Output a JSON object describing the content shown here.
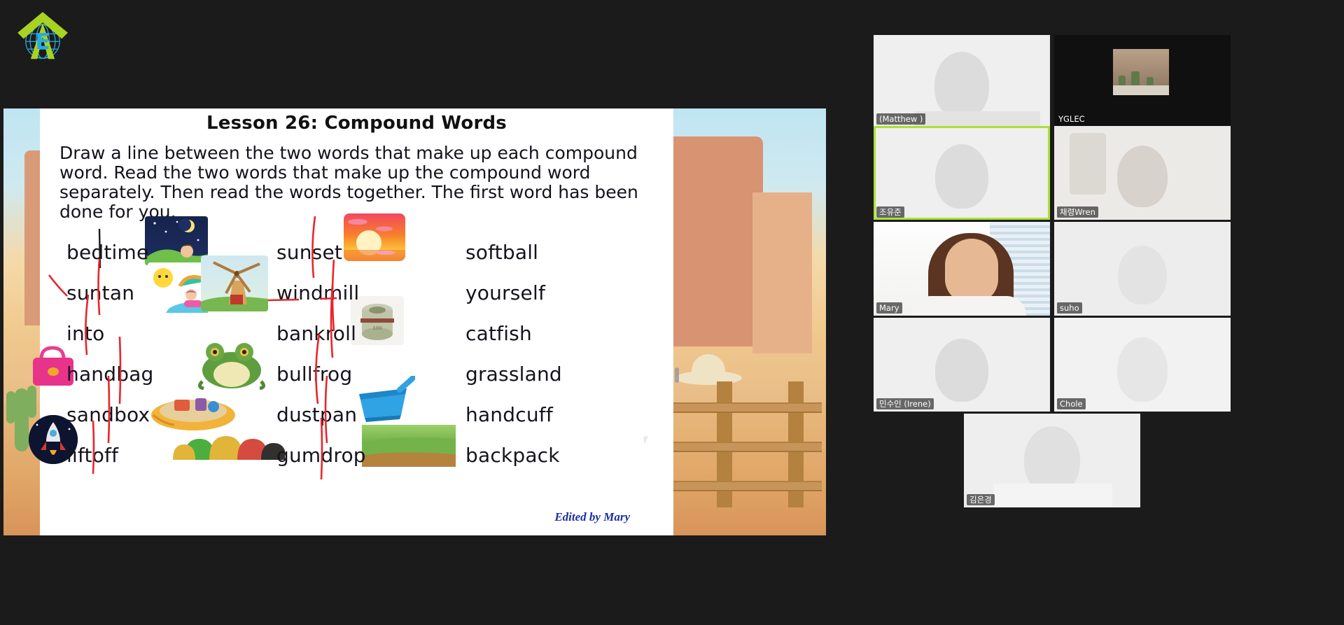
{
  "app": {
    "background_color": "#1b1b1b",
    "logo": {
      "name": "academy-globe-logo",
      "letter": "E",
      "arrow_color": "#a8d320",
      "globe_color": "#29abe2"
    }
  },
  "shared_screen": {
    "name": "shared-slide",
    "worksheet": {
      "title": "Lesson 26: Compound Words",
      "instructions": "Draw a line between the two words that make up each compound word. Read the two words that make up the compound word separately. Then read the words together. The first word has been done for you.",
      "columns": [
        {
          "index": 1,
          "words": [
            "bedtime",
            "suntan",
            "into",
            "handbag",
            "sandbox",
            "liftoff"
          ]
        },
        {
          "index": 2,
          "words": [
            "sunset",
            "windmill",
            "bankroll",
            "bullfrog",
            "dustpan",
            "gumdrop"
          ]
        },
        {
          "index": 3,
          "words": [
            "softball",
            "yourself",
            "catfish",
            "grassland",
            "handcuff",
            "backpack"
          ]
        }
      ],
      "clipart": [
        {
          "label": "night-sky-sleeping-child",
          "column": 1,
          "row": 1
        },
        {
          "label": "beach-umbrella-sunbathing",
          "column": 1,
          "row": 2
        },
        {
          "label": "pink-handbag",
          "column": 1,
          "row": 4
        },
        {
          "label": "sandbox-with-toys",
          "column": 1,
          "row": 5
        },
        {
          "label": "rocket-liftoff",
          "column": 1,
          "row": 6
        },
        {
          "label": "gumdrops-candy",
          "column": 1,
          "row": 6
        },
        {
          "label": "windmill",
          "column": 2,
          "row": 2
        },
        {
          "label": "sunset-ocean",
          "column": 2,
          "row": 1
        },
        {
          "label": "roll-of-money",
          "column": 2,
          "row": 3
        },
        {
          "label": "green-bullfrog",
          "column": 2,
          "row": 4
        },
        {
          "label": "blue-dustpan",
          "column": 2,
          "row": 5
        },
        {
          "label": "grass-field",
          "column": 3,
          "row": 5
        }
      ],
      "annotation_color": "#e8262b",
      "credit": "Edited by Mary"
    },
    "slide_background": "desert-western-scene"
  },
  "video_grid": {
    "name": "participant-grid",
    "active_speaker": "조유준",
    "active_border_color": "#aee034",
    "participants": [
      {
        "name": "(Matthew )",
        "video_on": false,
        "row": 1,
        "col": 1
      },
      {
        "name": "YGLEC",
        "video_on": true,
        "row": 1,
        "col": 2
      },
      {
        "name": "조유준",
        "video_on": false,
        "row": 2,
        "col": 1,
        "active": true
      },
      {
        "name": "채령Wren",
        "video_on": false,
        "row": 2,
        "col": 2
      },
      {
        "name": "Mary",
        "video_on": true,
        "row": 3,
        "col": 1
      },
      {
        "name": "suho",
        "video_on": false,
        "row": 3,
        "col": 2
      },
      {
        "name": "민수인 (Irene)",
        "video_on": false,
        "row": 4,
        "col": 1
      },
      {
        "name": "Chole",
        "video_on": false,
        "row": 4,
        "col": 2
      },
      {
        "name": "김은경",
        "video_on": false,
        "row": 5,
        "col": 1
      }
    ]
  }
}
